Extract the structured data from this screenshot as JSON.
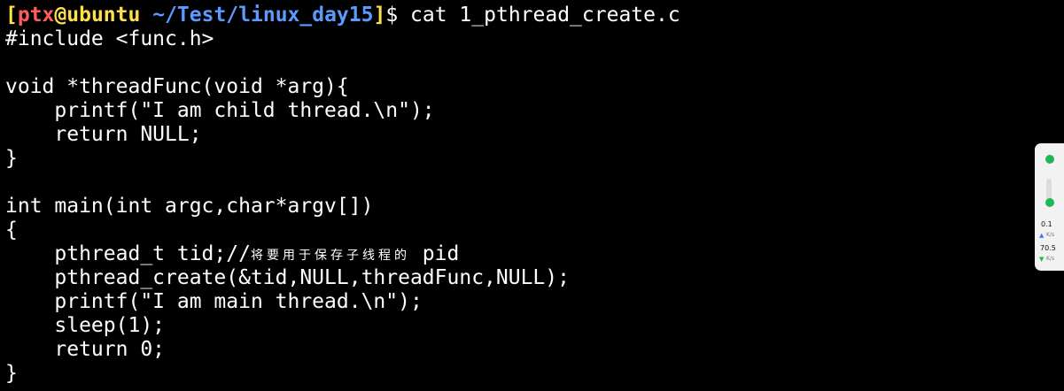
{
  "prompt": {
    "open_bracket": "[",
    "user": "ptx",
    "at": "@",
    "host": "ubuntu",
    "path": "~/Test/linux_day15",
    "close_bracket": "]",
    "symbol": "$",
    "command": "cat 1_pthread_create.c"
  },
  "file_lines": [
    "#include <func.h>",
    "",
    "void *threadFunc(void *arg){",
    "    printf(\"I am child thread.\\n\");",
    "    return NULL;",
    "}",
    "",
    "int main(int argc,char*argv[])",
    "{",
    "    pthread_t tid;//",
    "    pthread_create(&tid,NULL,threadFunc,NULL);",
    "    printf(\"I am main thread.\\n\");",
    "    sleep(1);",
    "    return 0;",
    "}"
  ],
  "comment_text": "将要用于保存子线程的",
  "comment_tail": " pid",
  "network_widget": {
    "upload_value": "0.1",
    "upload_unit": "K/s",
    "download_value": "70.5",
    "download_unit": "K/s"
  },
  "colors": {
    "background": "#000000",
    "text": "#ffffff",
    "prompt_bracket": "#ffe04a",
    "prompt_user": "#ff5c5c",
    "prompt_host": "#ffe04a",
    "prompt_path": "#5b9bff",
    "upload_arrow": "#3a7bff",
    "download_arrow": "#1fb757",
    "status_dot": "#1fb757"
  }
}
